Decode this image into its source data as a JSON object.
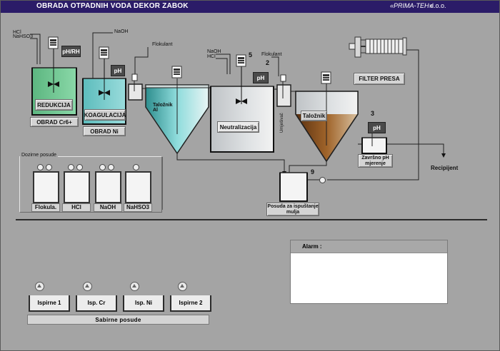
{
  "header": {
    "title": "OBRADA OTPADNIH VODA DEKOR ZABOK",
    "company": "«PRIMA-TEH»",
    "suffix": "d.o.o."
  },
  "tanks": {
    "reduction": {
      "label": "REDUKCIJA",
      "caption": "OBRAD Cr6+",
      "sensor": "pH/RH"
    },
    "coagulation": {
      "label": "KOAGULACIJA",
      "caption": "OBRAD Ni",
      "sensor": "pH"
    },
    "settler_al": {
      "label_line1": "Taložnik",
      "label_line2": "Al"
    },
    "neutralization": {
      "label": "Neutralizacija",
      "sensor": "pH",
      "number": "5"
    },
    "settler": {
      "label": "Taložnik",
      "number": "3"
    },
    "final_ph": {
      "sensor": "pH",
      "label_line1": "Završno pH",
      "label_line2": "mjerenje"
    },
    "sludge": {
      "label_line1": "Posuda za ispuštanje",
      "label_line2": "mulja",
      "number": "9"
    },
    "filter_press": {
      "label": "FILTER PRESA"
    },
    "mixer_vertical": {
      "label": "Umješivač",
      "number": "2"
    }
  },
  "chemicals": {
    "hcl": "HCl",
    "nahso3": "NaHSO3",
    "naoh_top": "NaOH",
    "flokulant_top": "Flokulant",
    "naoh_neut": "NaOH",
    "hcl_neut": "HCl",
    "flokulant_neut": "Flokulant"
  },
  "recipient": "Recipijent",
  "dosing": {
    "title": "Dozirne posude",
    "labels": [
      "Flokula.",
      "HCl",
      "NaOH",
      "NaHSO3"
    ]
  },
  "alarm": {
    "title": "Alarm :"
  },
  "rinse": {
    "labels": [
      "Ispirne 1",
      "Isp. Cr",
      "Isp. Ni",
      "Ispirne 2"
    ],
    "group": "Sabirne   posude"
  },
  "colors": {
    "titlebar": "#2b1c68",
    "background": "#a4a4a4",
    "green_liquid": "#74c896",
    "teal_liquid": "#74c8c8",
    "brown_sludge": "#7a4a1e"
  }
}
